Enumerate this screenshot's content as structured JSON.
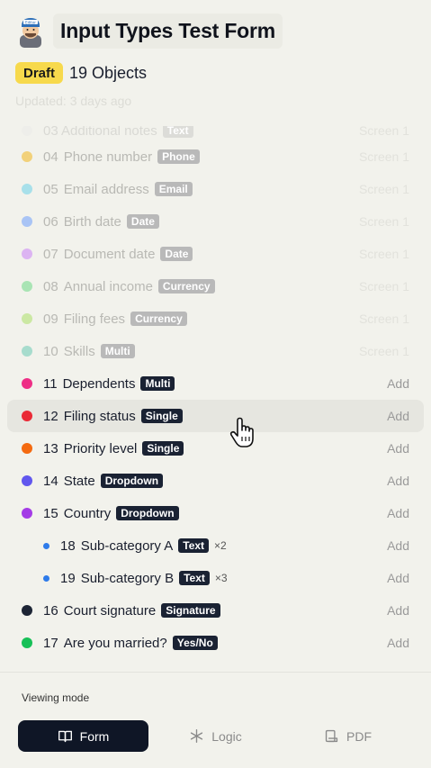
{
  "header": {
    "title": "Input Types Test Form",
    "status": "Draft",
    "object_count": "19 Objects",
    "updated": "Updated: 3 days ago",
    "avatar_badge": "Editor"
  },
  "partial_row": {
    "text": "03 Additional notes",
    "tag": "Text",
    "screen": "Screen 1"
  },
  "items": [
    {
      "num": "04",
      "label": "Phone number",
      "tag": "Phone",
      "right": "Screen 1",
      "color": "#f2d17a",
      "faded": true
    },
    {
      "num": "05",
      "label": "Email address",
      "tag": "Email",
      "right": "Screen 1",
      "color": "#a8e0ea",
      "faded": true
    },
    {
      "num": "06",
      "label": "Birth date",
      "tag": "Date",
      "right": "Screen 1",
      "color": "#a9c4f5",
      "faded": true
    },
    {
      "num": "07",
      "label": "Document date",
      "tag": "Date",
      "right": "Screen 1",
      "color": "#dcb4f2",
      "faded": true
    },
    {
      "num": "08",
      "label": "Annual income",
      "tag": "Currency",
      "right": "Screen 1",
      "color": "#a9e4b4",
      "faded": true
    },
    {
      "num": "09",
      "label": "Filing fees",
      "tag": "Currency",
      "right": "Screen 1",
      "color": "#cbe8a3",
      "faded": true
    },
    {
      "num": "10",
      "label": "Skills",
      "tag": "Multi",
      "right": "Screen 1",
      "color": "#a7dccd",
      "faded": true
    },
    {
      "num": "11",
      "label": "Dependents",
      "tag": "Multi",
      "right": "Add",
      "color": "#ee2f86"
    },
    {
      "num": "12",
      "label": "Filing status",
      "tag": "Single",
      "right": "Add",
      "color": "#ea2a36"
    },
    {
      "num": "13",
      "label": "Priority level",
      "tag": "Single",
      "right": "Add",
      "color": "#f46a10"
    },
    {
      "num": "14",
      "label": "State",
      "tag": "Dropdown",
      "right": "Add",
      "color": "#6157ee"
    },
    {
      "num": "15",
      "label": "Country",
      "tag": "Dropdown",
      "right": "Add",
      "color": "#a43ce6"
    },
    {
      "num": "18",
      "label": "Sub-category A",
      "tag": "Text",
      "mult": "×2",
      "right": "Add",
      "color": "#2e7bea",
      "sub": true
    },
    {
      "num": "19",
      "label": "Sub-category B",
      "tag": "Text",
      "mult": "×3",
      "right": "Add",
      "color": "#2e7bea",
      "sub": true
    },
    {
      "num": "16",
      "label": "Court signature",
      "tag": "Signature",
      "right": "Add",
      "color": "#1d2535"
    },
    {
      "num": "17",
      "label": "Are you married?",
      "tag": "Yes/No",
      "right": "Add",
      "color": "#17c057"
    }
  ],
  "footer": {
    "viewing_label": "Viewing mode",
    "modes": [
      {
        "label": "Form",
        "icon": "book-icon",
        "active": true
      },
      {
        "label": "Logic",
        "icon": "asterisk-icon",
        "active": false
      },
      {
        "label": "PDF",
        "icon": "pdf-icon",
        "active": false
      }
    ]
  },
  "colors": {
    "accent": "#0f1626",
    "draft": "#f7d94c",
    "background": "#f2f2ec"
  }
}
